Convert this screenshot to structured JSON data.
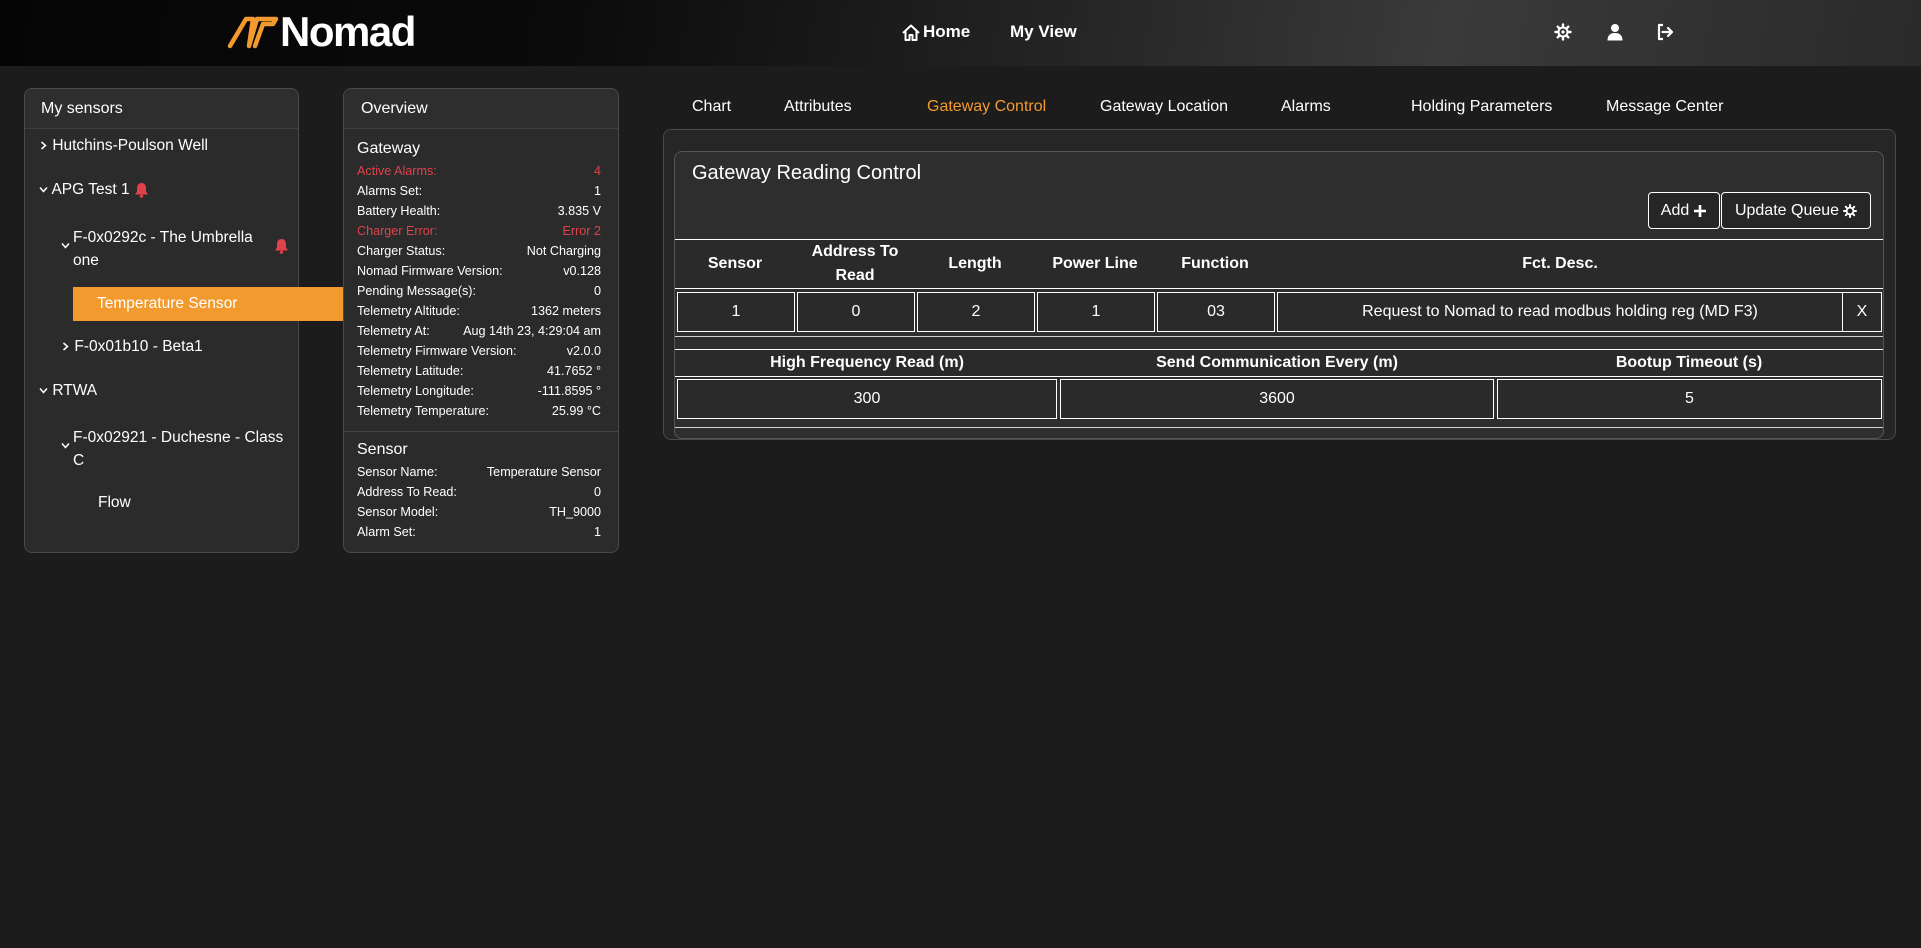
{
  "header": {
    "brand": "Nomad",
    "nav": {
      "home": "Home",
      "my_view": "My View"
    },
    "icons": [
      "settings-gear-icon",
      "user-icon",
      "logout-icon"
    ]
  },
  "colors": {
    "accent": "#f39a2e",
    "alert": "#e0414a",
    "background": "#1c1c1c",
    "panel": "#2b2b2b"
  },
  "sensors": {
    "title": "My sensors",
    "items": [
      {
        "label": "Hutchins-Poulson Well"
      },
      {
        "label": "APG Test 1"
      },
      {
        "label_line1": "F-0x0292c - The Umbrella",
        "label_line2": "one"
      },
      {
        "label": "Temperature Sensor"
      },
      {
        "label": "F-0x01b10 - Beta1"
      },
      {
        "label": "RTWA"
      },
      {
        "label_line1": "F-0x02921 - Duchesne - Class",
        "label_line2": "C"
      },
      {
        "label": "Flow"
      }
    ]
  },
  "overview": {
    "title": "Overview",
    "gateway_title": "Gateway",
    "gateway": [
      {
        "label": "Active Alarms:",
        "value": "4"
      },
      {
        "label": "Alarms Set:",
        "value": "1"
      },
      {
        "label": "Battery Health:",
        "value": "3.835 V"
      },
      {
        "label": "Charger Error:",
        "value": "Error 2"
      },
      {
        "label": "Charger Status:",
        "value": "Not Charging"
      },
      {
        "label": "Nomad Firmware Version:",
        "value": "v0.128"
      },
      {
        "label": "Pending Message(s):",
        "value": "0"
      },
      {
        "label": "Telemetry Altitude:",
        "value": "1362 meters"
      },
      {
        "label": "Telemetry At:",
        "value": "Aug 14th 23, 4:29:04 am"
      },
      {
        "label": "Telemetry Firmware Version:",
        "value": "v2.0.0"
      },
      {
        "label": "Telemetry Latitude:",
        "value": "41.7652 °"
      },
      {
        "label": "Telemetry Longitude:",
        "value": "-111.8595 °"
      },
      {
        "label": "Telemetry Temperature:",
        "value": "25.99 °C"
      }
    ],
    "sensor_title": "Sensor",
    "sensor": [
      {
        "label": "Sensor Name:",
        "value": "Temperature Sensor"
      },
      {
        "label": "Address To Read:",
        "value": "0"
      },
      {
        "label": "Sensor Model:",
        "value": "TH_9000"
      },
      {
        "label": "Alarm Set:",
        "value": "1"
      }
    ]
  },
  "tabs": [
    {
      "label": "Chart"
    },
    {
      "label": "Attributes"
    },
    {
      "label": "Gateway Control"
    },
    {
      "label": "Gateway Location"
    },
    {
      "label": "Alarms"
    },
    {
      "label": "Holding Parameters"
    },
    {
      "label": "Message Center"
    }
  ],
  "control": {
    "title": "Gateway Reading Control",
    "add_label": "Add",
    "update_label": "Update Queue",
    "headers": {
      "sensor": "Sensor",
      "address_line1": "Address To",
      "address_line2": "Read",
      "length": "Length",
      "power_line": "Power Line",
      "function": "Function",
      "fct_desc": "Fct. Desc."
    },
    "row": {
      "sensor": "1",
      "address": "0",
      "length": "2",
      "power_line": "1",
      "function": "03",
      "fct_desc": "Request to Nomad to read modbus holding reg (MD F3)",
      "delete": "X"
    },
    "timing_headers": {
      "hf": "High Frequency Read (m)",
      "comm": "Send Communication Every (m)",
      "boot": "Bootup Timeout (s)"
    },
    "timing": {
      "hf": "300",
      "comm": "3600",
      "boot": "5"
    }
  }
}
